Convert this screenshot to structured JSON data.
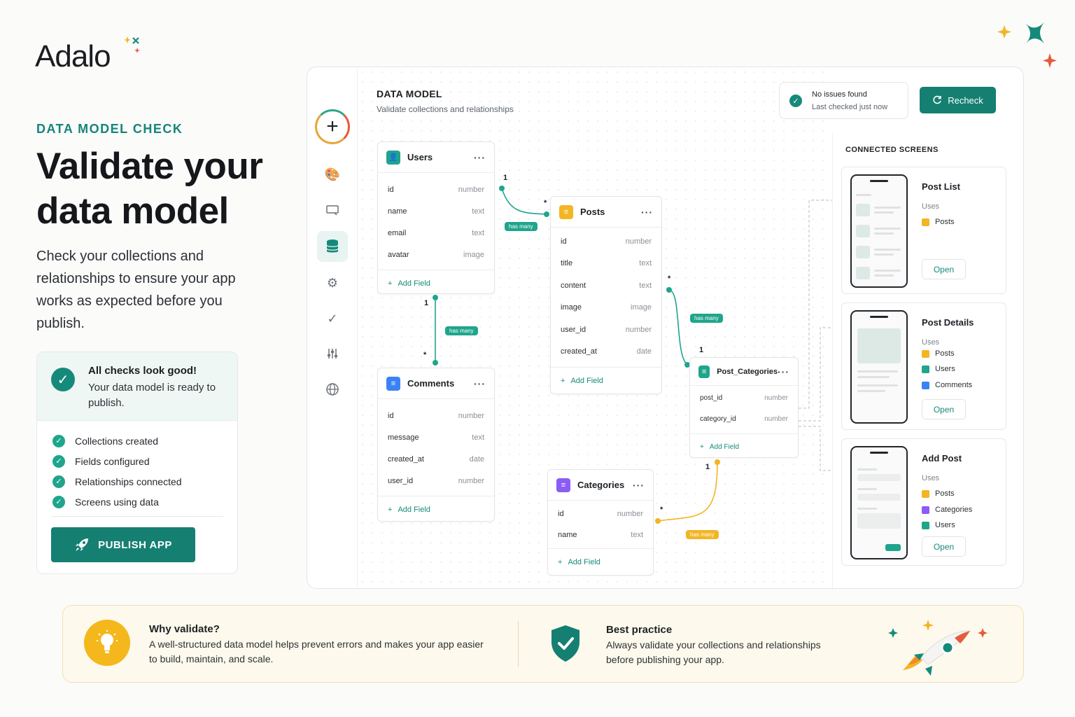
{
  "brand": {
    "name": "Adalo"
  },
  "hero": {
    "eyebrow": "DATA MODEL CHECK",
    "title_line1": "Validate your",
    "title_line2": "data model",
    "description": "Check your collections and relationships to ensure your app works as expected before you publish."
  },
  "check_card": {
    "heading": "All checks look good!",
    "subheading": "Your data model is ready to publish.",
    "items": [
      "Collections created",
      "Fields configured",
      "Relationships connected",
      "Screens using data"
    ],
    "publish_label": "PUBLISH APP"
  },
  "panel": {
    "title": "DATA MODEL",
    "subtitle": "Validate collections and relationships",
    "status_title": "No issues found",
    "status_time": "Last checked just now",
    "recheck_label": "Recheck"
  },
  "collections": {
    "users": {
      "name": "Users",
      "fields": [
        [
          "id",
          "number"
        ],
        [
          "name",
          "text"
        ],
        [
          "email",
          "text"
        ],
        [
          "avatar",
          "image"
        ]
      ],
      "add": "Add Field"
    },
    "posts": {
      "name": "Posts",
      "fields": [
        [
          "id",
          "number"
        ],
        [
          "title",
          "text"
        ],
        [
          "content",
          "text"
        ],
        [
          "image",
          "image"
        ],
        [
          "user_id",
          "number"
        ],
        [
          "created_at",
          "date"
        ]
      ],
      "add": "Add Field"
    },
    "comments": {
      "name": "Comments",
      "fields": [
        [
          "id",
          "number"
        ],
        [
          "message",
          "text"
        ],
        [
          "created_at",
          "date"
        ],
        [
          "user_id",
          "number"
        ]
      ],
      "add": "Add Field"
    },
    "post_categories": {
      "name": "Post_Categories",
      "fields": [
        [
          "post_id",
          "number"
        ],
        [
          "category_id",
          "number"
        ]
      ],
      "add": "Add Field"
    },
    "categories": {
      "name": "Categories",
      "fields": [
        [
          "id",
          "number"
        ],
        [
          "name",
          "text"
        ]
      ],
      "add": "Add Field"
    }
  },
  "relations": {
    "has_many": "has many",
    "one": "1",
    "many": "*"
  },
  "screens": {
    "title": "CONNECTED SCREENS",
    "uses_label": "Uses",
    "open_label": "Open",
    "items": [
      {
        "name": "Post List",
        "uses": [
          "Posts"
        ]
      },
      {
        "name": "Post Details",
        "uses": [
          "Posts",
          "Users",
          "Comments"
        ]
      },
      {
        "name": "Add Post",
        "uses": [
          "Posts",
          "Categories",
          "Users"
        ]
      }
    ]
  },
  "banner": {
    "why_title": "Why validate?",
    "why_text": "A well-structured data model helps prevent errors and makes your app easier to build, maintain, and scale.",
    "best_title": "Best practice",
    "best_text": "Always validate your collections and relationships before publishing your app."
  },
  "colors": {
    "accent": "#157f72",
    "posts": "#f2b524",
    "users": "#1fa58c",
    "comments": "#3b82f6",
    "categories": "#8b5cf6"
  }
}
